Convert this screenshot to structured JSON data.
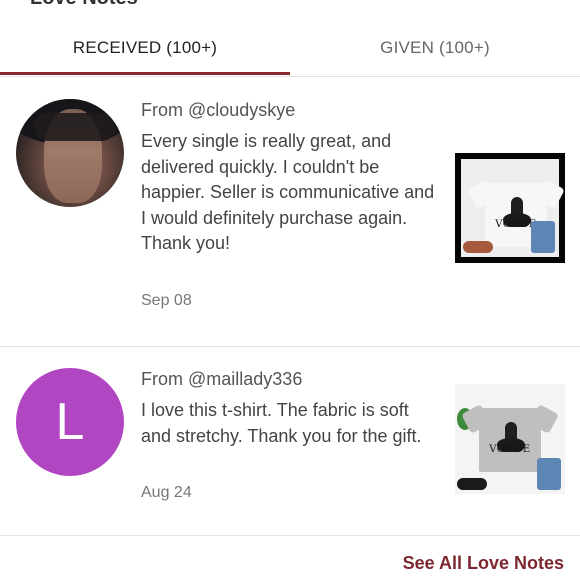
{
  "page": {
    "heading": "Love Notes"
  },
  "tabs": [
    {
      "label": "RECEIVED (100+)",
      "active": true
    },
    {
      "label": "GIVEN (100+)",
      "active": false
    }
  ],
  "notes": [
    {
      "from": "From @cloudyskye",
      "text": "Every single is really great, and delivered quickly. I couldn't be happier. Seller is communicative and I would definitely purchase again. Thank you!",
      "date": "Sep 08",
      "avatar_letter": "",
      "thumb_text": "VOGUE"
    },
    {
      "from": "From @maillady336",
      "text": "I love this t-shirt. The fabric is soft and stretchy. Thank you for the gift.",
      "date": "Aug 24",
      "avatar_letter": "L",
      "thumb_text": "VOGUE"
    }
  ],
  "footer": {
    "link": "See All Love Notes"
  },
  "colors": {
    "accent": "#8c2a31",
    "avatar_purple": "#b146c2"
  }
}
